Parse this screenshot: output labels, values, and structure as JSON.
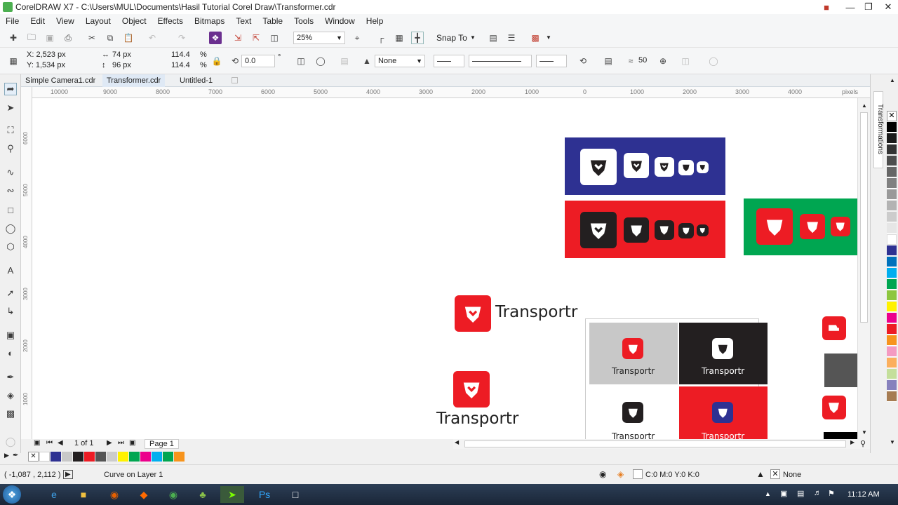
{
  "window": {
    "title": "CorelDRAW X7 - C:\\Users\\MUL\\Documents\\Hasil Tutorial Corel Draw\\Transformer.cdr"
  },
  "menu": [
    "File",
    "Edit",
    "View",
    "Layout",
    "Object",
    "Effects",
    "Bitmaps",
    "Text",
    "Table",
    "Tools",
    "Window",
    "Help"
  ],
  "toolbar": {
    "zoom": "25%",
    "snap_to": "Snap To"
  },
  "property_bar": {
    "x": "X: 2,523 px",
    "y": "Y: 1,534 px",
    "w": "74 px",
    "h": "96 px",
    "scale_w": "114.4",
    "scale_h": "114.4",
    "pct": "%",
    "angle": "0.0",
    "outline": "None",
    "smoothing": "50"
  },
  "tabs": [
    "Simple Camera1.cdr",
    "Transformer.cdr",
    "Untitled-1"
  ],
  "active_tab": 1,
  "hruler": {
    "ticks": [
      "10000",
      "9000",
      "8000",
      "7000",
      "6000",
      "5000",
      "4000",
      "3000",
      "2000",
      "1000",
      "0",
      "1000",
      "2000",
      "3000",
      "4000"
    ],
    "unit": "pixels"
  },
  "vruler": {
    "ticks": [
      "6000",
      "5000",
      "4000",
      "3000",
      "2000",
      "1000"
    ]
  },
  "docker": {
    "label": "Transformations"
  },
  "canvas": {
    "brand_text": "Transportr"
  },
  "page_nav": {
    "count": "1 of 1",
    "page_tab": "Page 1"
  },
  "status": {
    "coords": "( -1,087 , 2,112 )",
    "object": "Curve on Layer 1",
    "fill": "C:0 M:0 Y:0 K:0",
    "outline": "None"
  },
  "taskbar": {
    "time": "11:12 AM"
  },
  "colors": {
    "brand_red": "#ed1c24",
    "brand_blue": "#2e3192",
    "brand_green": "#00a651",
    "brand_dark": "#231f20"
  }
}
